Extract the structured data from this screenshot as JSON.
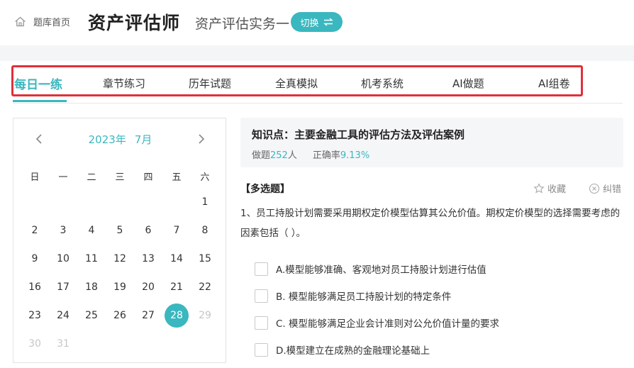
{
  "header": {
    "home_label": "题库首页",
    "site_title": "资产评估师",
    "subject": "资产评估实务一",
    "switch_label": "切换"
  },
  "tabs": [
    {
      "label": "每日一练",
      "active": true
    },
    {
      "label": "章节练习"
    },
    {
      "label": "历年试题"
    },
    {
      "label": "全真模拟"
    },
    {
      "label": "机考系统"
    },
    {
      "label": "AI做题"
    },
    {
      "label": "AI组卷"
    }
  ],
  "calendar": {
    "year": "2023年",
    "month": "7月",
    "weekdays": [
      "日",
      "一",
      "二",
      "三",
      "四",
      "五",
      "六"
    ],
    "days": [
      [
        "",
        "",
        "",
        "",
        "",
        "",
        "1"
      ],
      [
        "2",
        "3",
        "4",
        "5",
        "6",
        "7",
        "8"
      ],
      [
        "9",
        "10",
        "11",
        "12",
        "13",
        "14",
        "15"
      ],
      [
        "16",
        "17",
        "18",
        "19",
        "20",
        "21",
        "22"
      ],
      [
        "23",
        "24",
        "25",
        "26",
        "27",
        "28",
        "29"
      ],
      [
        "30",
        "31",
        "",
        "",
        "",
        "",
        ""
      ]
    ],
    "selected_day": "28",
    "muted_days": [
      "29",
      "30",
      "31"
    ]
  },
  "knowledge_point": {
    "title": "知识点：主要金融工具的评估方法及评估案例",
    "done_label": "做题",
    "done_count": "252",
    "done_unit": "人",
    "accuracy_label": "正确率",
    "accuracy_value": "9.13%"
  },
  "question": {
    "type": "【多选题】",
    "favorite_label": "收藏",
    "report_label": "纠错",
    "text": "1、员工持股计划需要采用期权定价模型估算其公允价值。期权定价模型的选择需要考虑的因素包括（    ）。",
    "options": [
      "A.模型能够准确、客观地对员工持股计划进行估值",
      "B. 模型能够满足员工持股计划的特定条件",
      "C. 模型能够满足企业会计准则对公允价值计量的要求",
      "D.模型建立在成熟的金融理论基础上"
    ]
  },
  "colors": {
    "accent": "#3ab7bf",
    "highlight_box": "#e0303a"
  }
}
